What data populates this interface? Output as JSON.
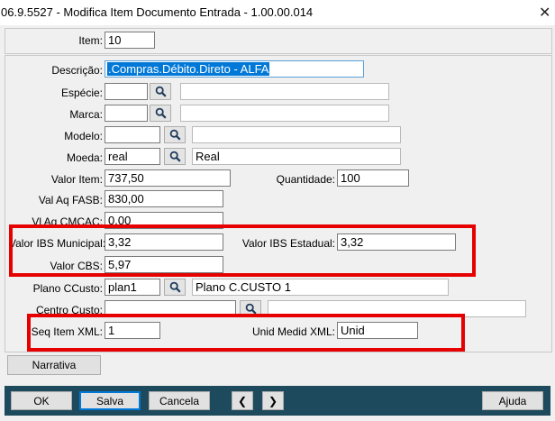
{
  "window": {
    "title": "06.9.5527 - Modifica Item Documento Entrada - 1.00.00.014"
  },
  "fields": {
    "item": {
      "label": "Item:",
      "value": "10"
    },
    "descricao": {
      "label": "Descrição:",
      "value": ".Compras.Débito.Direto - ALFA"
    },
    "especie": {
      "label": "Espécie:",
      "value": "",
      "desc": ""
    },
    "marca": {
      "label": "Marca:",
      "value": "",
      "desc": ""
    },
    "modelo": {
      "label": "Modelo:",
      "value": "",
      "desc": ""
    },
    "moeda": {
      "label": "Moeda:",
      "value": "real",
      "desc": "Real"
    },
    "valor_item": {
      "label": "Valor Item:",
      "value": "737,50"
    },
    "quantidade": {
      "label": "Quantidade:",
      "value": "100"
    },
    "val_aq_fasb": {
      "label": "Val Aq FASB:",
      "value": "830,00"
    },
    "vl_aq_cmcac": {
      "label": "Vl Aq CMCAC:",
      "value": "0,00"
    },
    "valor_ibs_municipal": {
      "label": "Valor IBS Municipal:",
      "value": "3,32"
    },
    "valor_ibs_estadual": {
      "label": "Valor IBS Estadual:",
      "value": "3,32"
    },
    "valor_cbs": {
      "label": "Valor CBS:",
      "value": "5,97"
    },
    "plano_ccusto": {
      "label": "Plano CCusto:",
      "value": "plan1",
      "desc": "Plano C.CUSTO 1"
    },
    "centro_custo": {
      "label": "Centro Custo:",
      "value": "",
      "desc": ""
    },
    "seq_item_xml": {
      "label": "Seq Item XML:",
      "value": "1"
    },
    "unid_medid_xml": {
      "label": "Unid Medid XML:",
      "value": "Unid"
    }
  },
  "buttons": {
    "narrativa": "Narrativa",
    "ok": "OK",
    "salva": "Salva",
    "cancela": "Cancela",
    "prev": "❮",
    "next": "❯",
    "ajuda": "Ajuda"
  },
  "colors": {
    "highlight": "#e60000",
    "bottom_bar": "#1d4a5c",
    "selection": "#0078d7"
  }
}
